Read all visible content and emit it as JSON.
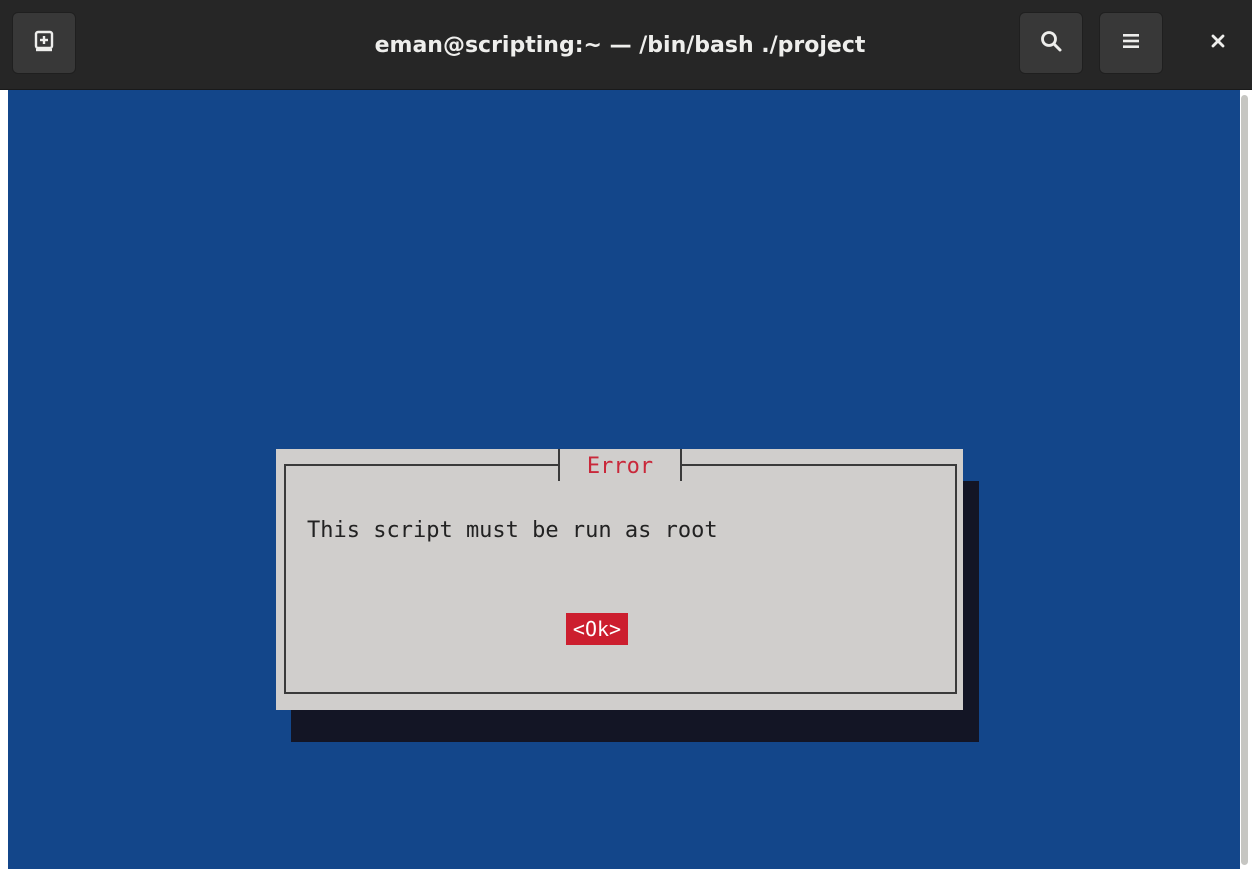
{
  "window": {
    "title": "eman@scripting:~ — /bin/bash ./project"
  },
  "headerbar": {
    "icons": [
      "new-tab-icon",
      "search-icon",
      "hamburger-menu-icon",
      "close-icon"
    ]
  },
  "dialog": {
    "title": "Error",
    "message": "This script must be run as root",
    "ok_label": "<Ok>"
  },
  "colors": {
    "terminal_background": "#13468a",
    "dialog_background": "#d0cecc",
    "title_text": "#c9283a",
    "button_highlight": "#cc1e2e"
  }
}
